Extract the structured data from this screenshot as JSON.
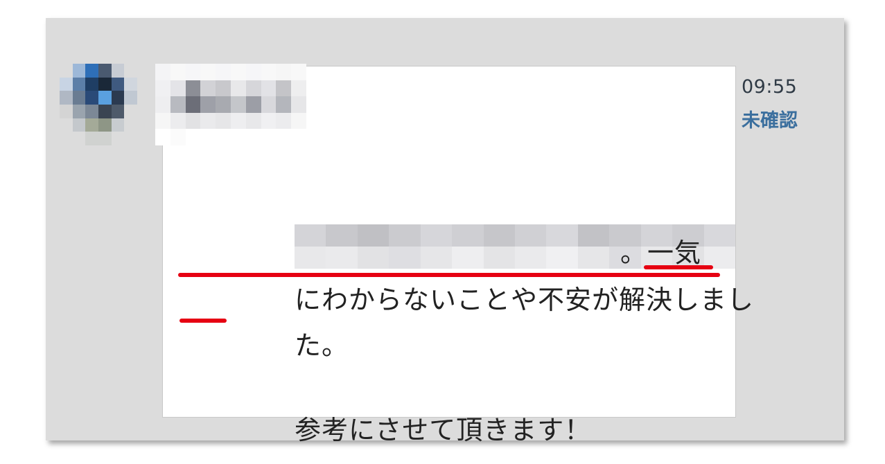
{
  "chat": {
    "message": {
      "line1_tail": "。一気",
      "line2": "にわからないことや不安が解決しまし",
      "line3": "た。",
      "line4": "参考にさせて頂きます！"
    },
    "time": "09:55",
    "status": "未確認"
  },
  "colors": {
    "panel_background": "#dcdcdc",
    "bubble_background": "#ffffff",
    "underline_red": "#e60012",
    "status_blue": "#3b6f9e"
  }
}
